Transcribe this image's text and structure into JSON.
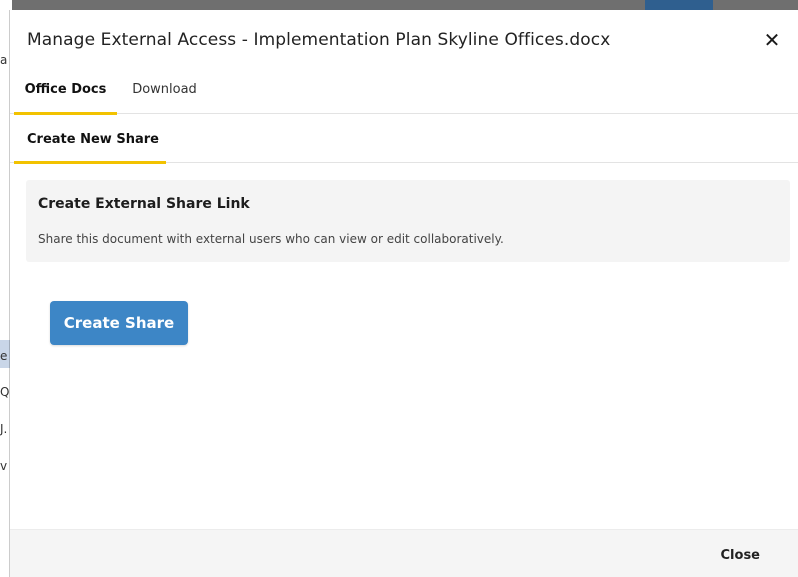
{
  "background": {
    "glyphs": [
      "a",
      "",
      "",
      "e",
      "Q",
      "J.",
      "v"
    ]
  },
  "dialog": {
    "title": "Manage External Access - Implementation Plan Skyline Offices.docx",
    "close_icon": "close-icon",
    "close_glyph": "✕",
    "tabs": [
      {
        "label": "Office Docs",
        "active": true
      },
      {
        "label": "Download",
        "active": false
      }
    ],
    "subtabs": [
      {
        "label": "Create New Share",
        "active": true
      }
    ],
    "panel": {
      "title": "Create External Share Link",
      "description": "Share this document with external users who can view or edit collaboratively."
    },
    "create_button_label": "Create Share",
    "footer_close_label": "Close"
  },
  "colors": {
    "accent_underline": "#f2c200",
    "primary_button": "#3d86c6",
    "panel_bg": "#f4f4f4"
  }
}
